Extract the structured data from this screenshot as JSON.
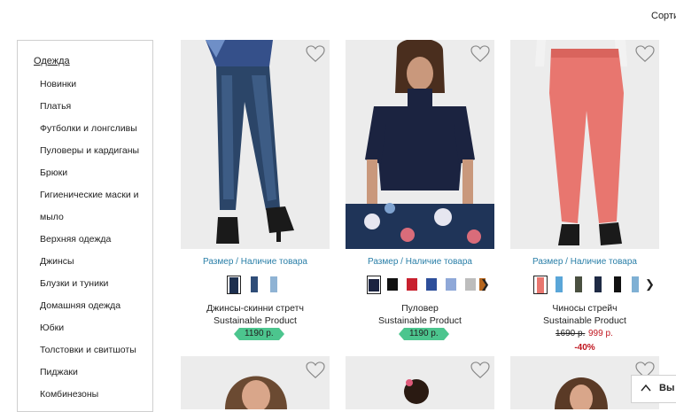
{
  "toolbar": {
    "sort_label": "Сорти"
  },
  "sidebar": {
    "heading": "Одежда",
    "items": [
      {
        "label": "Новинки"
      },
      {
        "label": "Платья"
      },
      {
        "label": "Футболки и лонгсливы"
      },
      {
        "label": "Пуловеры и кардиганы"
      },
      {
        "label": "Брюки"
      },
      {
        "label": "Гигиенические маски и"
      },
      {
        "label": "мыло"
      },
      {
        "label": "Верхняя одежда"
      },
      {
        "label": "Джинсы"
      },
      {
        "label": "Блузки и туники"
      },
      {
        "label": "Домашняя одежда"
      },
      {
        "label": "Юбки"
      },
      {
        "label": "Толстовки и свитшоты"
      },
      {
        "label": "Пиджаки"
      },
      {
        "label": "Комбинезоны"
      }
    ]
  },
  "products": [
    {
      "size_link": "Размер / Наличие товара",
      "name": "Джинсы-скинни стретч",
      "tag": "Sustainable Product",
      "price": "1190 р.",
      "swatches": [
        "#1d2f4f",
        "#2f4d78",
        "#8fb3d4"
      ]
    },
    {
      "size_link": "Размер / Наличие товара",
      "name": "Пуловер",
      "tag": "Sustainable Product",
      "price": "1190 р.",
      "swatches": [
        "#1b2340",
        "#111111",
        "#c8202e",
        "#2d4e9a",
        "#8fa8d8",
        "#bdbdbd",
        "#b5651d"
      ]
    },
    {
      "size_link": "Размер / Наличие товара",
      "name": "Чиносы стрейч",
      "tag": "Sustainable Product",
      "old_price": "1690 р.",
      "new_price": "999 р.",
      "discount": "-40%",
      "swatches": [
        "#e8766f",
        "#5aa6d8",
        "#4a5040",
        "#1e2a44",
        "#111111",
        "#7fb0d4"
      ]
    }
  ],
  "scroll_top": {
    "label": "Вы"
  },
  "colors": {
    "accent_link": "#2a7fa8",
    "price_badge": "#4cc58e",
    "sale_red": "#c0161f"
  }
}
